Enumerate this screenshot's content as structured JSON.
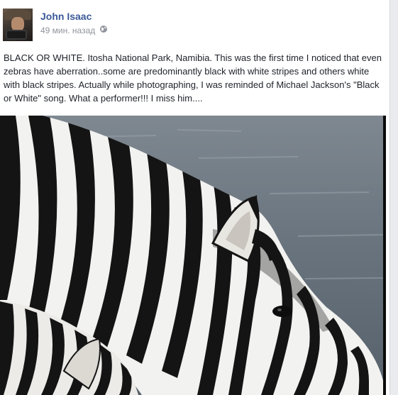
{
  "post": {
    "author": "John Isaac",
    "timestamp": "49 мин. назад",
    "privacy_icon": "globe-icon",
    "text": "BLACK OR WHITE. Itosha National Park, Namibia. This was the first time I noticed that even zebras have aberration..some are predominantly black with white stripes and others white with black stripes. Actually while photographing, I was reminded of Michael Jackson's \"Black or White\" song. What a performer!!! I miss him....",
    "photo": {
      "subject": "zebra",
      "colors": {
        "water": "#6f7a82",
        "stripe_dark": "#141414",
        "stripe_light": "#f2f2f0"
      }
    }
  },
  "colors": {
    "link": "#3b5998",
    "meta": "#90949c",
    "text": "#1d2129"
  }
}
